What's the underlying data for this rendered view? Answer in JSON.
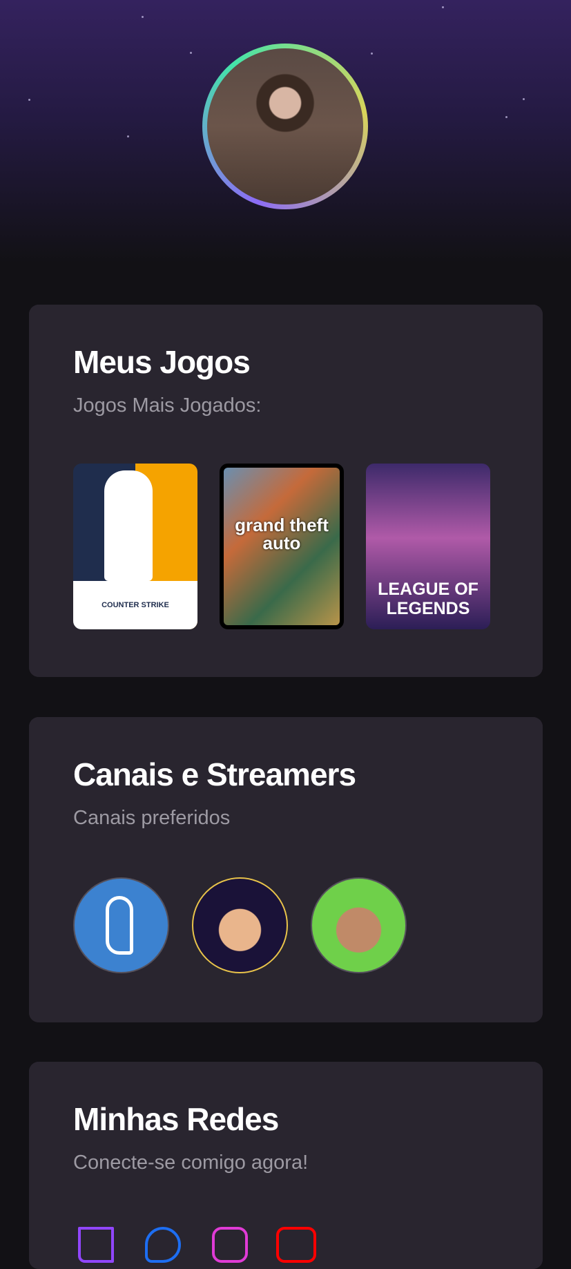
{
  "profile": {
    "avatar": "profile-photo"
  },
  "games": {
    "title": "Meus Jogos",
    "subtitle": "Jogos Mais Jogados:",
    "items": [
      {
        "name": "Counter-Strike: Global Offensive",
        "label": "COUNTER STRIKE"
      },
      {
        "name": "Grand Theft Auto V",
        "label": "grand theft auto"
      },
      {
        "name": "League of Legends",
        "label": "LEAGUE OF LEGENDS"
      }
    ]
  },
  "channels": {
    "title": "Canais e Streamers",
    "subtitle": "Canais preferidos",
    "items": [
      "channel-1",
      "channel-2",
      "channel-3"
    ]
  },
  "social": {
    "title": "Minhas Redes",
    "subtitle": "Conecte-se comigo agora!",
    "items": [
      {
        "icon": "twitch-icon",
        "color": "#9146ff"
      },
      {
        "icon": "twitter-icon",
        "color": "#1d6ef2"
      },
      {
        "icon": "instagram-icon",
        "color": "#e03bd6"
      },
      {
        "icon": "youtube-icon",
        "color": "#ff0000"
      }
    ]
  }
}
